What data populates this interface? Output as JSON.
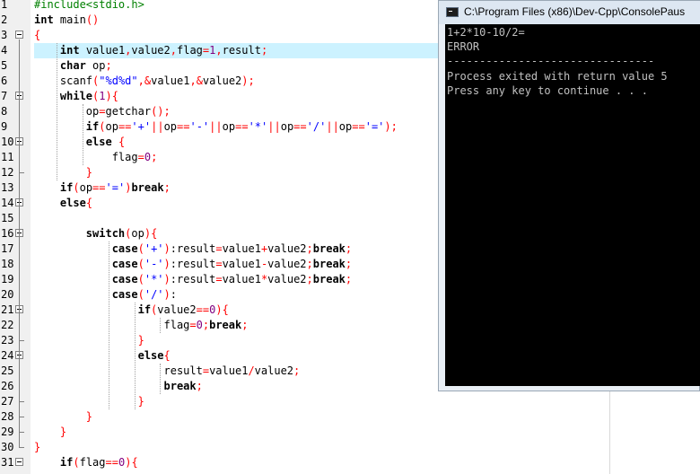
{
  "editor": {
    "current_line": 4,
    "lines": [
      {
        "n": "1",
        "code": "#include<stdio.h>",
        "fold": false
      },
      {
        "n": "2",
        "code": "int main()",
        "fold": false
      },
      {
        "n": "3",
        "code": "{",
        "fold": true
      },
      {
        "n": "4",
        "code": "    int value1,value2,flag=1,result;",
        "fold": false
      },
      {
        "n": "5",
        "code": "    char op;",
        "fold": false
      },
      {
        "n": "6",
        "code": "    scanf(\"%d%d\",&value1,&value2);",
        "fold": false
      },
      {
        "n": "7",
        "code": "    while(1){",
        "fold": true
      },
      {
        "n": "8",
        "code": "        op=getchar();",
        "fold": false
      },
      {
        "n": "9",
        "code": "        if(op=='+'||op=='-'||op=='*'||op=='/'||op=='=');",
        "fold": false
      },
      {
        "n": "10",
        "code": "        else {",
        "fold": true
      },
      {
        "n": "11",
        "code": "            flag=0;",
        "fold": false
      },
      {
        "n": "12",
        "code": "        }",
        "fold": false
      },
      {
        "n": "13",
        "code": "    if(op=='=')break;",
        "fold": false
      },
      {
        "n": "14",
        "code": "    else{",
        "fold": true
      },
      {
        "n": "15",
        "code": "",
        "fold": false
      },
      {
        "n": "16",
        "code": "        switch(op){",
        "fold": true
      },
      {
        "n": "17",
        "code": "            case('+'):result=value1+value2;break;",
        "fold": false
      },
      {
        "n": "18",
        "code": "            case('-'):result=value1-value2;break;",
        "fold": false
      },
      {
        "n": "19",
        "code": "            case('*'):result=value1*value2;break;",
        "fold": false
      },
      {
        "n": "20",
        "code": "            case('/'):",
        "fold": false
      },
      {
        "n": "21",
        "code": "                if(value2==0){",
        "fold": true
      },
      {
        "n": "22",
        "code": "                    flag=0;break;",
        "fold": false
      },
      {
        "n": "23",
        "code": "                }",
        "fold": false
      },
      {
        "n": "24",
        "code": "                else{",
        "fold": true
      },
      {
        "n": "25",
        "code": "                    result=value1/value2;",
        "fold": false
      },
      {
        "n": "26",
        "code": "                    break;",
        "fold": false
      },
      {
        "n": "27",
        "code": "                }",
        "fold": false
      },
      {
        "n": "28",
        "code": "        }",
        "fold": false
      },
      {
        "n": "29",
        "code": "    }",
        "fold": false
      },
      {
        "n": "30",
        "code": "}",
        "fold": false
      },
      {
        "n": "31",
        "code": "    if(flag==0){",
        "fold": true
      }
    ]
  },
  "console": {
    "title": "C:\\Program Files (x86)\\Dev-Cpp\\ConsolePaus",
    "lines": [
      "1+2*10-10/2=",
      "ERROR",
      "--------------------------------",
      "Process exited with return value 5",
      "Press any key to continue . . ."
    ]
  },
  "colors": {
    "current_line_bg": "#ccf2ff",
    "keyword": "#000000",
    "string": "#0000ff",
    "operator": "#ff0000",
    "preprocessor": "#008000",
    "console_bg": "#000000",
    "console_text": "#c0c0c0"
  }
}
